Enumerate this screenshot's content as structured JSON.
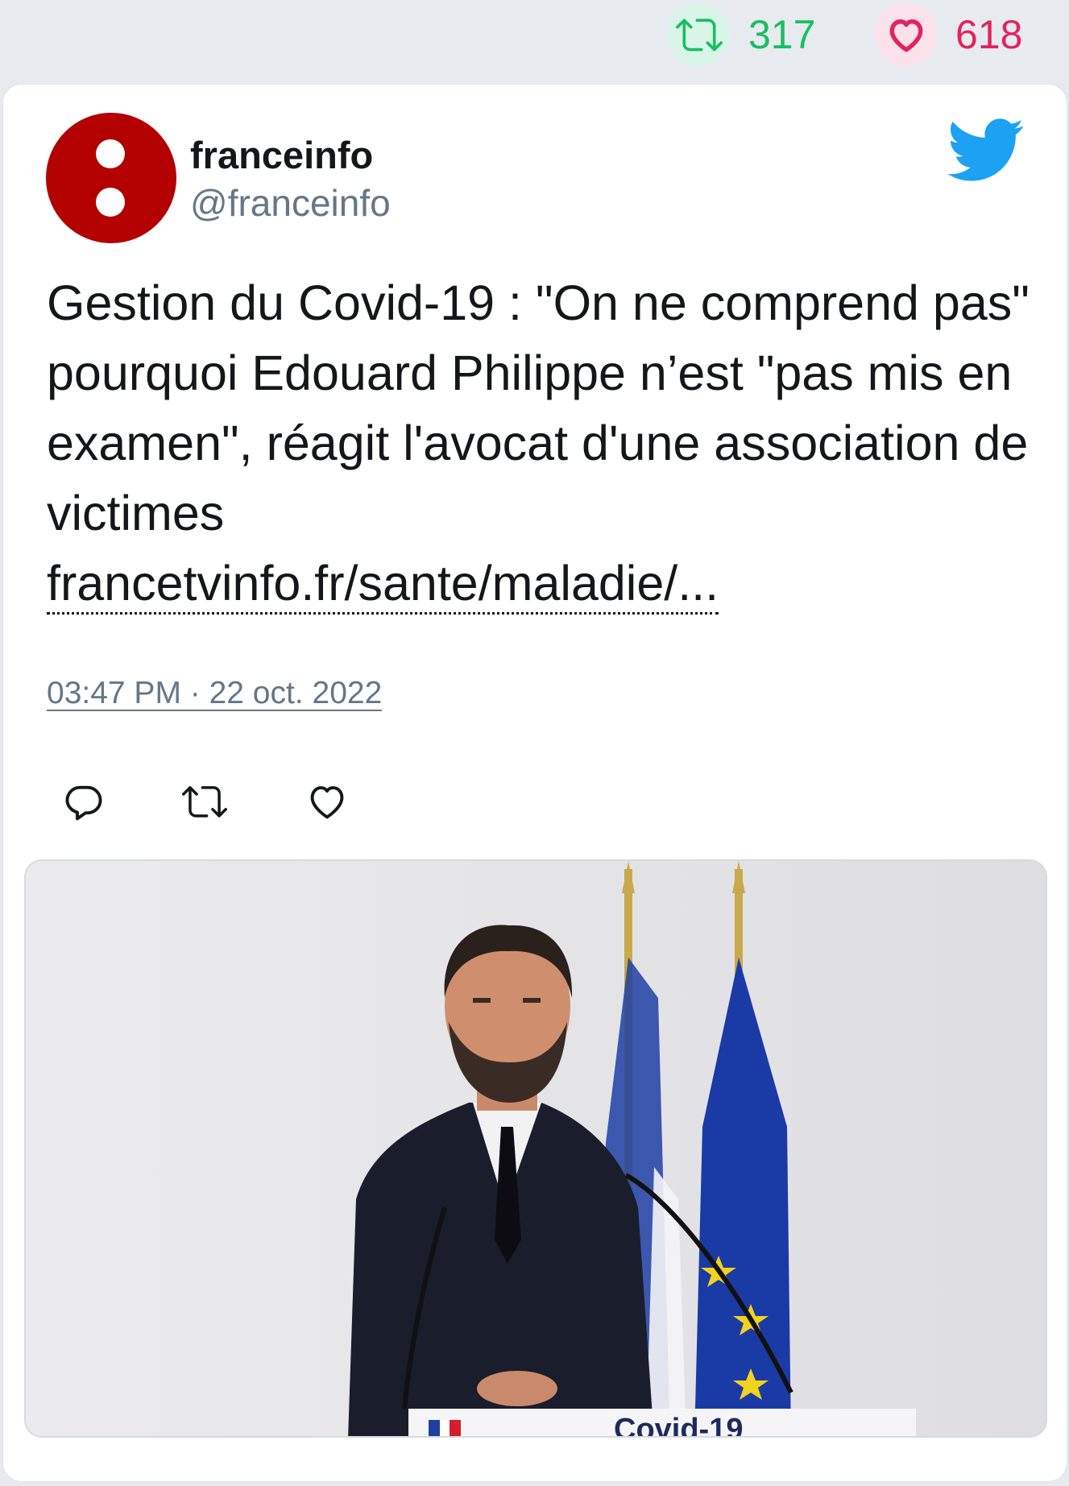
{
  "stats": {
    "retweets": "317",
    "likes": "618",
    "retweet_color": "#17bf63",
    "like_color": "#e0245e"
  },
  "tweet": {
    "author_name": "franceinfo",
    "author_handle": "@franceinfo",
    "text": "Gestion du Covid-19 : \"On ne comprend pas\" pourquoi Edouard Philippe n’est \"pas mis en examen\", réagit l'avocat d'une association de victimes",
    "link_text": "francetvinfo.fr/sante/maladie/...",
    "timestamp": "03:47 PM · 22 oct. 2022",
    "avatar_color": "#b30000",
    "brand_icon": "twitter-bird-icon"
  },
  "actions": {
    "icons": [
      "reply-icon",
      "retweet-icon",
      "like-icon"
    ]
  },
  "media": {
    "image_icon": "press-conference-photo",
    "podium_text": "Covid-19"
  }
}
